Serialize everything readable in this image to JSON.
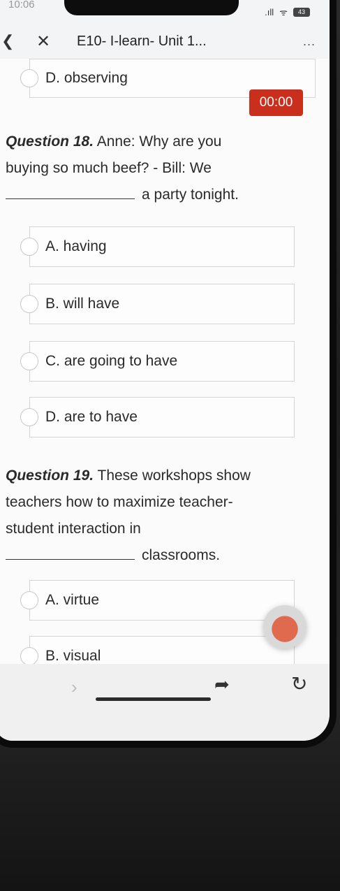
{
  "status_bar": {
    "clock": "10:06",
    "signal": ".ıll",
    "wifi": "ᯤ",
    "battery": "43"
  },
  "header": {
    "title": "E10- I-learn- Unit 1...",
    "more": "..."
  },
  "timer": "00:00",
  "previous_question": {
    "option_d": "D. observing"
  },
  "question18": {
    "label": "Question 18.",
    "text_line1": "Anne: Why are you",
    "text_line2": "buying so much beef? - Bill: We",
    "text_line3": "a party tonight.",
    "options": [
      "A. having",
      "B. will have",
      "C. are going to have",
      "D. are to have"
    ]
  },
  "question19": {
    "label": "Question 19.",
    "text_line1": "These workshops show",
    "text_line2": "teachers how to maximize teacher-",
    "text_line3": "student interaction in",
    "text_line4": "classrooms.",
    "options": [
      "A. virtue",
      "B. visual"
    ]
  },
  "icons": {
    "back": "back-icon",
    "close": "close-icon",
    "more": "more-icon",
    "nav_back": "chevron-left-icon",
    "nav_forward": "chevron-right-icon",
    "share": "share-icon",
    "reload": "reload-icon"
  }
}
